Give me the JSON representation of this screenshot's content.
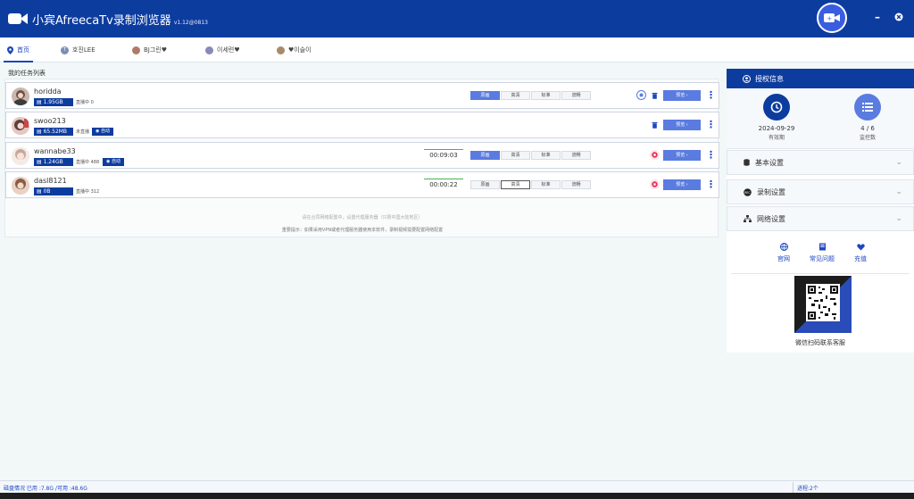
{
  "app": {
    "title": "小宾AfreecaTv录制浏览器",
    "version": "v1.12@0813"
  },
  "tabs": [
    {
      "label": "首页",
      "icon": "map-pin-icon",
      "active": true
    },
    {
      "label": "호진LEE",
      "icon": "avatar-icon"
    },
    {
      "label": "BJ그린♥",
      "icon": "avatar-icon"
    },
    {
      "label": "이세련♥",
      "icon": "avatar-icon"
    },
    {
      "label": "♥이슬이",
      "icon": "avatar-icon"
    }
  ],
  "task_list": {
    "label": "我的任务列表",
    "tasks": [
      {
        "name": "horidda",
        "size": "1.95GB",
        "status": "直播中",
        "status_count": "0",
        "live_badge": "",
        "timer": "",
        "quality": [
          "原画",
          "高清",
          "标准",
          "流畅"
        ],
        "selected_quality": 0,
        "preview_label": "预览 ›"
      },
      {
        "name": "swoo213",
        "size": "65.52MB",
        "status": "未直播",
        "status_count": "",
        "live_badge": "自动",
        "timer": "",
        "quality": [],
        "selected_quality": -1,
        "preview_label": "预览 ›"
      },
      {
        "name": "wannabe33",
        "size": "1.24GB",
        "status": "直播中",
        "status_count": "488",
        "live_badge": "自动",
        "timer": "00:09:03",
        "quality": [
          "原画",
          "高清",
          "标准",
          "流畅"
        ],
        "selected_quality": 0,
        "preview_label": "预览 ›"
      },
      {
        "name": "dasl8121",
        "size": "0B",
        "status": "直播中",
        "status_count": "312",
        "live_badge": "",
        "timer": "00:00:22",
        "quality": [
          "原画",
          "高清",
          "标准",
          "流畅"
        ],
        "selected_quality": 1,
        "preview_label": "预览 ›"
      }
    ],
    "note_primary": "请在合同网络配置中，设置代理服务器（只限中国大陆地区）",
    "note_secondary": "重要提示：如果采用VPN或者代理服务器使用本软件，录制视频需要配置网络配置"
  },
  "sidebar": {
    "auth_title": "授权信息",
    "expiry_value": "2024-09-29",
    "expiry_label": "有效期",
    "monitor_value": "4 / 6",
    "monitor_label": "监控数",
    "sections": [
      "基本设置",
      "录制设置",
      "网络设置"
    ],
    "links": [
      "官网",
      "常见问题",
      "充值"
    ],
    "qr_caption": "微信扫码联系客服"
  },
  "statusbar": {
    "disk": "磁盘情况 已用 :7.8G /可用 :48.6G",
    "process": "进程:2个"
  },
  "colors": {
    "primary": "#0d3c9f",
    "accent": "#5a7be0",
    "live_green": "#4bb052",
    "record_red": "#e0305a"
  }
}
